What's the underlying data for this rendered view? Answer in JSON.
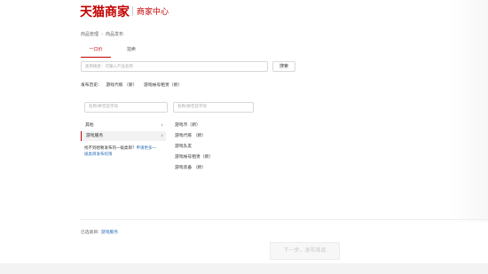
{
  "header": {
    "logo_text": "天猫商家",
    "subtitle": "商家中心"
  },
  "breadcrumb": {
    "items": [
      "商品管理",
      "商品发布"
    ]
  },
  "tabs": [
    {
      "label": "一口价",
      "active": true
    },
    {
      "label": "拍卖",
      "active": false
    }
  ],
  "search": {
    "placeholder": "类目搜索：可输入产品名称",
    "button_label": "搜索"
  },
  "history": {
    "label": "发布历史:",
    "items": [
      "游戏代练 （新）",
      "游戏帐号租赁（新）"
    ]
  },
  "columns": {
    "col1_placeholder": "名称/拼音首字母",
    "col2_placeholder": "名称/拼音首字母"
  },
  "level1": [
    {
      "label": "其他",
      "selected": false
    },
    {
      "label": "游戏服务",
      "selected": true
    }
  ],
  "notfound": {
    "text": "找不到想要发布的一级类目？",
    "link1": "申请更多一",
    "link2": "级类目发布权限"
  },
  "level2": [
    "游戏币（新）",
    "游戏代练 （新）",
    "游戏队友",
    "游戏帐号租赁（新）",
    "游戏装备 （新）"
  ],
  "selected": {
    "label": "已选类目:",
    "value": "游戏服务"
  },
  "next_button": {
    "label": "下一步，发布商品"
  },
  "colors": {
    "brand": "#c40000",
    "link": "#2a6fb8"
  }
}
